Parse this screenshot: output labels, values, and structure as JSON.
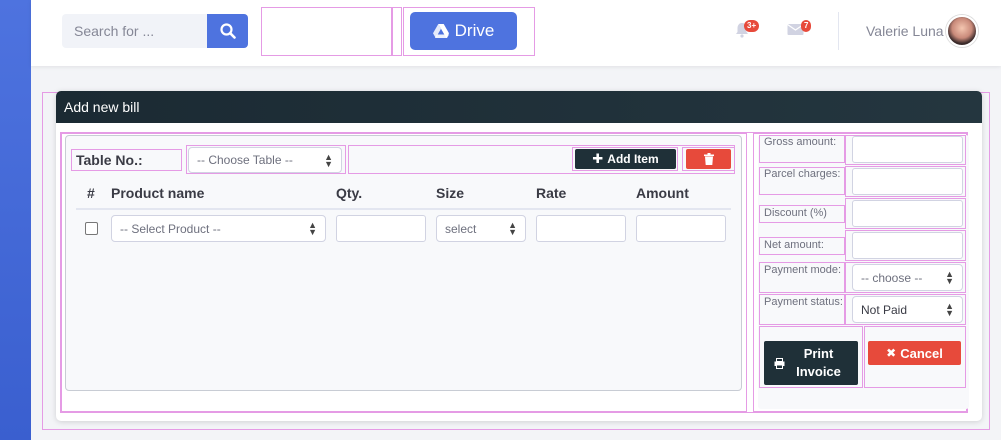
{
  "header": {
    "search_placeholder": "Search for ...",
    "drive_label": "Drive",
    "alerts_badge": "3+",
    "messages_badge": "7",
    "user_name": "Valerie Luna"
  },
  "card": {
    "title": "Add new bill"
  },
  "items": {
    "table_label": "Table No.:",
    "table_select": "-- Choose Table --",
    "add_item_label": "Add Item",
    "columns": [
      "#",
      "Product name",
      "Qty.",
      "Size",
      "Rate",
      "Amount"
    ],
    "row": {
      "product_select": "-- Select Product --",
      "size_select": "select"
    }
  },
  "summary": {
    "gross_label": "Gross amount:",
    "parcel_label": "Parcel charges:",
    "discount_label": "Discount (%)",
    "net_label": "Net amount:",
    "payment_mode_label": "Payment mode:",
    "payment_mode_value": "-- choose --",
    "payment_status_label": "Payment status:",
    "payment_status_value": "Not Paid",
    "print_label": "Print Invoice",
    "cancel_label": "Cancel"
  },
  "colors": {
    "primary": "#4e73df",
    "danger": "#e74a3b",
    "dark": "#1f3038"
  }
}
